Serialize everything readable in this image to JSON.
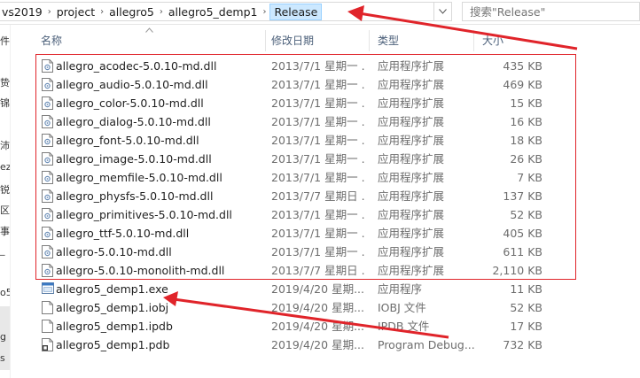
{
  "breadcrumb": {
    "items": [
      "vs2019",
      "project",
      "allegro5",
      "allegro5_demp1"
    ],
    "current": "Release",
    "separator": "›"
  },
  "search": {
    "placeholder": "搜索\"Release\""
  },
  "nav": {
    "items": [
      "件",
      "贽",
      "锦",
      "沛",
      "ez",
      "锐",
      "区",
      "事",
      "_",
      "o5",
      "g",
      "s"
    ]
  },
  "columns": {
    "name": "名称",
    "date": "修改日期",
    "type": "类型",
    "size": "大小"
  },
  "files": [
    {
      "name": "allegro_acodec-5.0.10-md.dll",
      "date": "2013/7/1 星期一 ...",
      "type": "应用程序扩展",
      "size": "435 KB",
      "icon": "dll-file-icon",
      "highlighted": true
    },
    {
      "name": "allegro_audio-5.0.10-md.dll",
      "date": "2013/7/1 星期一 ...",
      "type": "应用程序扩展",
      "size": "469 KB",
      "icon": "dll-file-icon",
      "highlighted": true
    },
    {
      "name": "allegro_color-5.0.10-md.dll",
      "date": "2013/7/1 星期一 ...",
      "type": "应用程序扩展",
      "size": "15 KB",
      "icon": "dll-file-icon",
      "highlighted": true
    },
    {
      "name": "allegro_dialog-5.0.10-md.dll",
      "date": "2013/7/1 星期一 ...",
      "type": "应用程序扩展",
      "size": "16 KB",
      "icon": "dll-file-icon",
      "highlighted": true
    },
    {
      "name": "allegro_font-5.0.10-md.dll",
      "date": "2013/7/1 星期一 ...",
      "type": "应用程序扩展",
      "size": "18 KB",
      "icon": "dll-file-icon",
      "highlighted": true
    },
    {
      "name": "allegro_image-5.0.10-md.dll",
      "date": "2013/7/1 星期一 ...",
      "type": "应用程序扩展",
      "size": "26 KB",
      "icon": "dll-file-icon",
      "highlighted": true
    },
    {
      "name": "allegro_memfile-5.0.10-md.dll",
      "date": "2013/7/1 星期一 ...",
      "type": "应用程序扩展",
      "size": "7 KB",
      "icon": "dll-file-icon",
      "highlighted": true
    },
    {
      "name": "allegro_physfs-5.0.10-md.dll",
      "date": "2013/7/7 星期日 ...",
      "type": "应用程序扩展",
      "size": "137 KB",
      "icon": "dll-file-icon",
      "highlighted": true
    },
    {
      "name": "allegro_primitives-5.0.10-md.dll",
      "date": "2013/7/1 星期一 ...",
      "type": "应用程序扩展",
      "size": "52 KB",
      "icon": "dll-file-icon",
      "highlighted": true
    },
    {
      "name": "allegro_ttf-5.0.10-md.dll",
      "date": "2013/7/1 星期一 ...",
      "type": "应用程序扩展",
      "size": "405 KB",
      "icon": "dll-file-icon",
      "highlighted": true
    },
    {
      "name": "allegro-5.0.10-md.dll",
      "date": "2013/7/1 星期一 ...",
      "type": "应用程序扩展",
      "size": "611 KB",
      "icon": "dll-file-icon",
      "highlighted": true
    },
    {
      "name": "allegro-5.0.10-monolith-md.dll",
      "date": "2013/7/7 星期日 ...",
      "type": "应用程序扩展",
      "size": "2,110 KB",
      "icon": "dll-file-icon",
      "highlighted": true
    },
    {
      "name": "allegro5_demp1.exe",
      "date": "2019/4/20 星期...",
      "type": "应用程序",
      "size": "11 KB",
      "icon": "exe-file-icon",
      "highlighted": false
    },
    {
      "name": "allegro5_demp1.iobj",
      "date": "2019/4/20 星期...",
      "type": "IOBJ 文件",
      "size": "52 KB",
      "icon": "blank-file-icon",
      "highlighted": false
    },
    {
      "name": "allegro5_demp1.ipdb",
      "date": "2019/4/20 星期...",
      "type": "IPDB 文件",
      "size": "17 KB",
      "icon": "blank-file-icon",
      "highlighted": false
    },
    {
      "name": "allegro5_demp1.pdb",
      "date": "2019/4/20 星期...",
      "type": "Program Debug...",
      "size": "732 KB",
      "icon": "pdb-file-icon",
      "highlighted": false
    }
  ],
  "annotation_color": "#e0242a",
  "selection_color": "#cce8ff"
}
